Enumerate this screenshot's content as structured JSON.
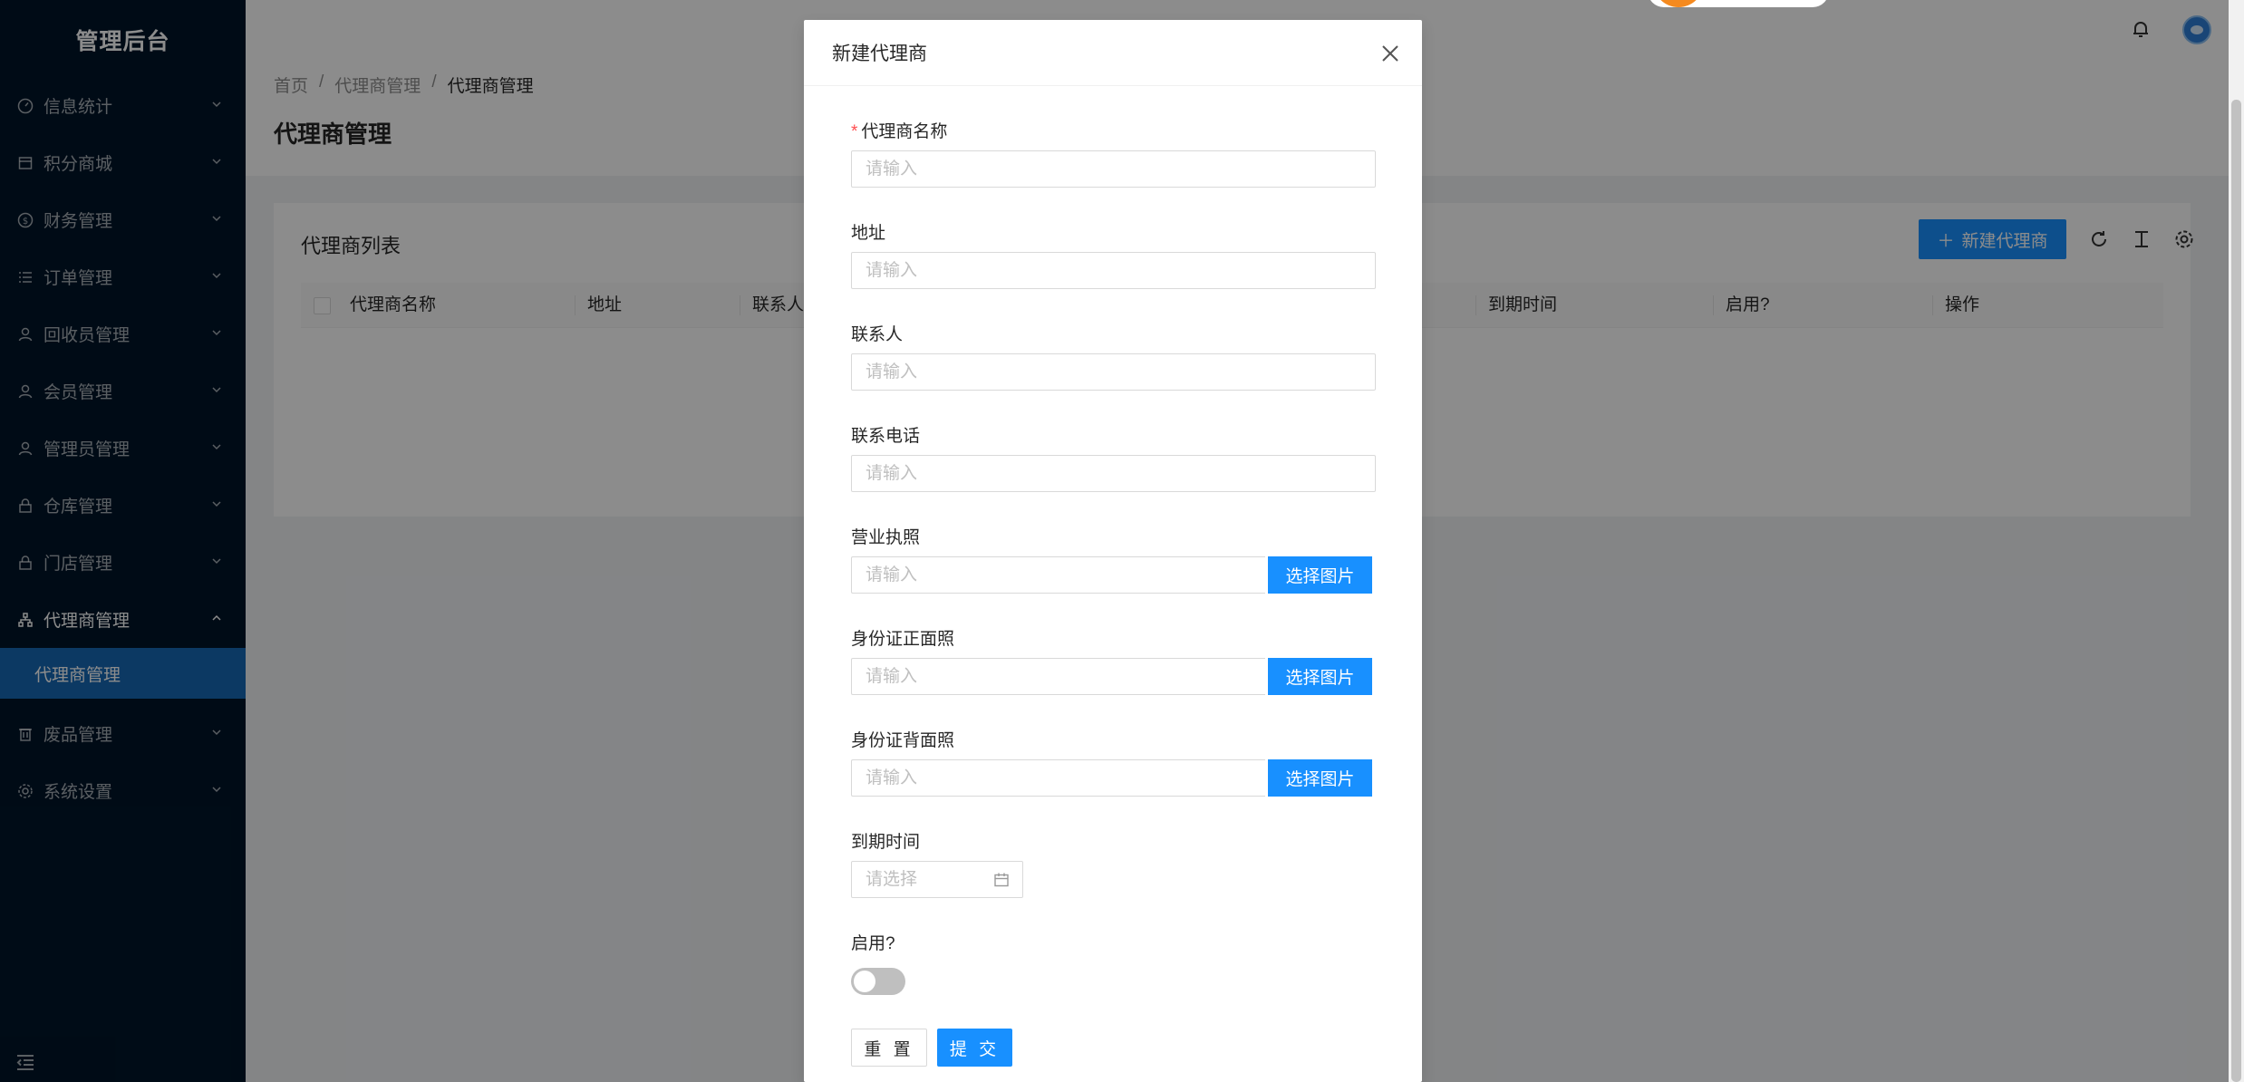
{
  "app": {
    "title": "管理后台"
  },
  "sidebar": {
    "items": [
      {
        "label": "信息统计",
        "icon": "dashboard-icon"
      },
      {
        "label": "积分商城",
        "icon": "shop-icon"
      },
      {
        "label": "财务管理",
        "icon": "dollar-icon"
      },
      {
        "label": "订单管理",
        "icon": "list-icon"
      },
      {
        "label": "回收员管理",
        "icon": "user-icon"
      },
      {
        "label": "会员管理",
        "icon": "user-icon"
      },
      {
        "label": "管理员管理",
        "icon": "user-icon"
      },
      {
        "label": "仓库管理",
        "icon": "lock-icon"
      },
      {
        "label": "门店管理",
        "icon": "lock-icon"
      },
      {
        "label": "代理商管理",
        "icon": "cluster-icon"
      },
      {
        "label": "废品管理",
        "icon": "delete-icon"
      },
      {
        "label": "系统设置",
        "icon": "setting-icon"
      }
    ],
    "submenu_label": "代理商管理"
  },
  "breadcrumb": {
    "home": "首页",
    "parent": "代理商管理",
    "current": "代理商管理",
    "sep": "/"
  },
  "page": {
    "title": "代理商管理"
  },
  "table": {
    "title": "代理商列表",
    "new_button": "新建代理商",
    "columns": [
      "代理商名称",
      "地址",
      "联系人",
      "到期时间",
      "启用?",
      "操作"
    ]
  },
  "modal": {
    "title": "新建代理商",
    "fields": {
      "name": {
        "label": "代理商名称",
        "placeholder": "请输入",
        "required_mark": "*"
      },
      "address": {
        "label": "地址",
        "placeholder": "请输入"
      },
      "contact": {
        "label": "联系人",
        "placeholder": "请输入"
      },
      "phone": {
        "label": "联系电话",
        "placeholder": "请输入"
      },
      "license": {
        "label": "营业执照",
        "placeholder": "请输入",
        "button": "选择图片"
      },
      "id_front": {
        "label": "身份证正面照",
        "placeholder": "请输入",
        "button": "选择图片"
      },
      "id_back": {
        "label": "身份证背面照",
        "placeholder": "请输入",
        "button": "选择图片"
      },
      "expire": {
        "label": "到期时间",
        "placeholder": "请选择"
      },
      "enabled": {
        "label": "启用?",
        "value": false
      }
    },
    "reset_button": "重 置",
    "submit_button": "提 交"
  },
  "colors": {
    "primary": "#1890ff",
    "sidebar_bg": "#001529",
    "selected_menu": "#1668b5"
  }
}
